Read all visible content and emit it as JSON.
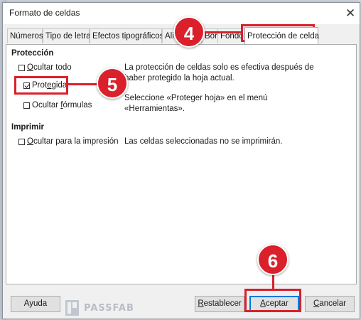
{
  "dialog": {
    "title": "Formato de celdas"
  },
  "tabs": [
    {
      "label": "Números"
    },
    {
      "label": "Tipo de letra"
    },
    {
      "label": "Efectos tipográficos"
    },
    {
      "label": "Alineación"
    },
    {
      "label": "Bordes"
    },
    {
      "label": "Fondo"
    },
    {
      "label": "Protección de celda"
    }
  ],
  "protection": {
    "heading": "Protección",
    "hide_all": {
      "label_pre": "",
      "label_u": "O",
      "label_post": "cultar todo",
      "checked": false
    },
    "protected": {
      "label_pre": "Prot",
      "label_u": "e",
      "label_post": "gida",
      "checked": true
    },
    "hide_formulas": {
      "label_pre": "Ocultar ",
      "label_u": "f",
      "label_post": "órmulas",
      "checked": false
    },
    "desc1_line1": "La protección de celdas solo es efectiva después de",
    "desc1_line2": "haber protegido la hoja actual.",
    "desc2_line1": "Seleccione «Proteger hoja» en el menú",
    "desc2_line2": "«Herramientas»."
  },
  "print": {
    "heading": "Imprimir",
    "hide_print": {
      "label_pre": "",
      "label_u": "O",
      "label_post": "cultar para la impresión",
      "checked": false
    },
    "desc": "Las celdas seleccionadas no se imprimirán."
  },
  "buttons": {
    "help": "Ayuda",
    "reset_pre": "",
    "reset_u": "R",
    "reset_post": "establecer",
    "ok_pre": "",
    "ok_u": "A",
    "ok_post": "ceptar",
    "cancel_pre": "",
    "cancel_u": "C",
    "cancel_post": "ancelar"
  },
  "callouts": {
    "c4": "4",
    "c5": "5",
    "c6": "6"
  },
  "watermark": {
    "text": "PASSFAB"
  },
  "colors": {
    "accent": "#d9202b",
    "focus": "#0078d7"
  }
}
